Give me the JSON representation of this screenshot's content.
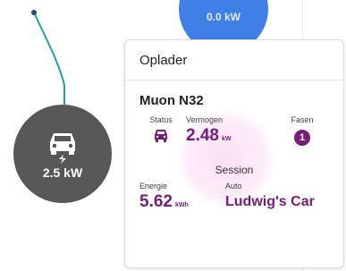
{
  "colors": {
    "accent": "#7a1a7a",
    "node_gray": "#575757",
    "top_node_blue": "#3f7fe6",
    "connector_teal": "#1fa3a0"
  },
  "diagram": {
    "top_node_label": "0.0 kW",
    "charger_node": {
      "icon": "car-charging-icon",
      "power": "2.5 kW"
    }
  },
  "card": {
    "title": "Oplader",
    "charger_name": "Muon N32",
    "status": {
      "label": "Status",
      "icon": "car-icon"
    },
    "power": {
      "label": "Vermogen",
      "value": "2.48",
      "unit": "kW"
    },
    "phases": {
      "label": "Fasen",
      "value": "1"
    },
    "session": {
      "heading": "Session",
      "energy": {
        "label": "Energie",
        "value": "5.62",
        "unit": "kWh"
      },
      "car": {
        "label": "Auto",
        "value": "Ludwig's Car"
      }
    }
  }
}
